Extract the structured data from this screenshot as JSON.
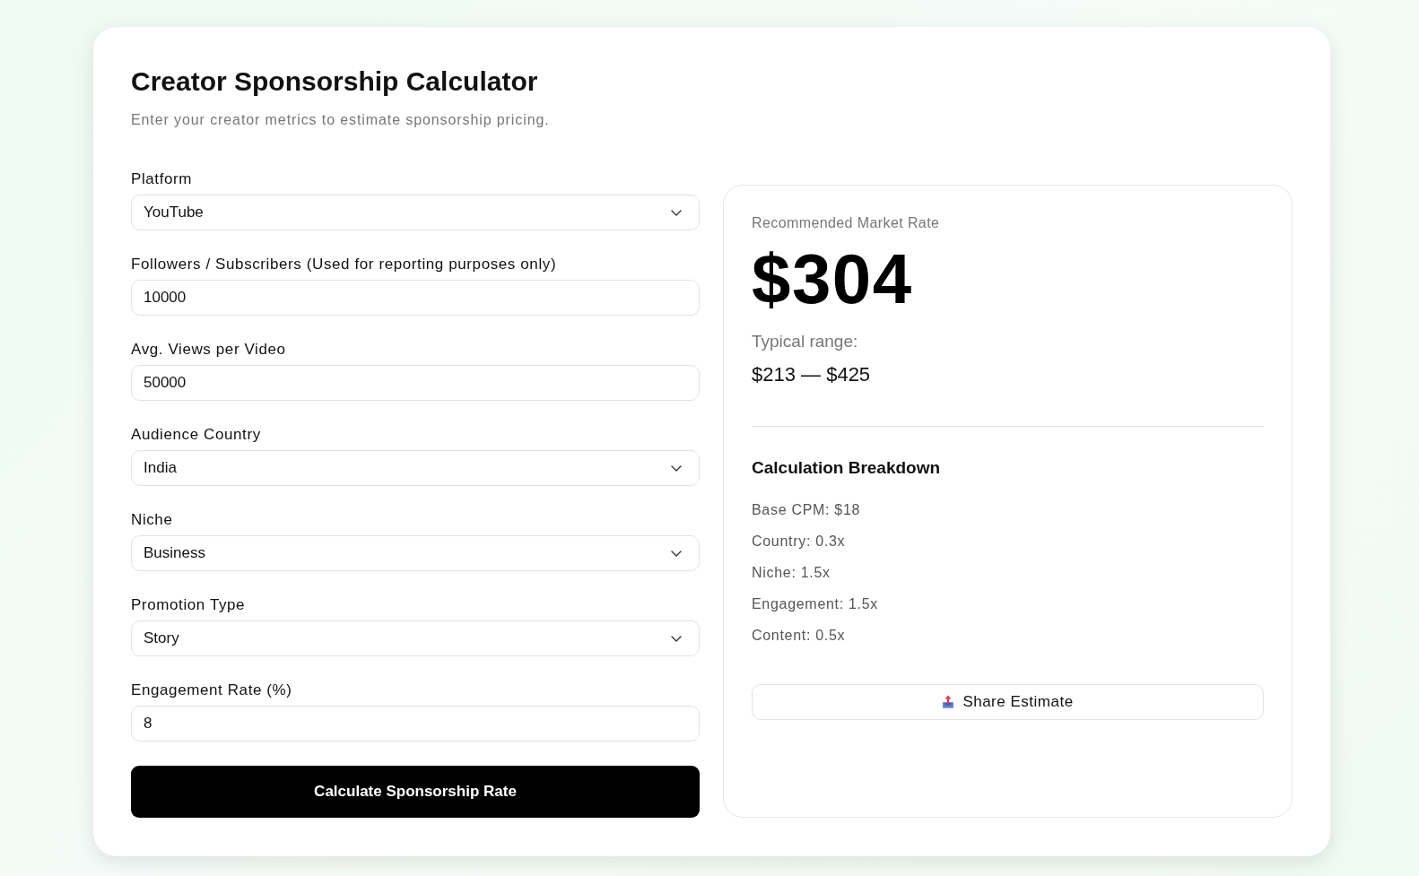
{
  "header": {
    "title": "Creator Sponsorship Calculator",
    "subtitle": "Enter your creator metrics to estimate sponsorship pricing."
  },
  "form": {
    "fields": [
      {
        "kind": "select",
        "label": "Platform",
        "value": "YouTube"
      },
      {
        "kind": "input",
        "label": "Followers / Subscribers (Used for reporting purposes only)",
        "value": "10000"
      },
      {
        "kind": "input",
        "label": "Avg. Views per Video",
        "value": "50000"
      },
      {
        "kind": "select",
        "label": "Audience Country",
        "value": "India"
      },
      {
        "kind": "select",
        "label": "Niche",
        "value": "Business"
      },
      {
        "kind": "select",
        "label": "Promotion Type",
        "value": "Story"
      },
      {
        "kind": "input",
        "label": "Engagement Rate (%)",
        "value": "8"
      }
    ],
    "submit": "Calculate Sponsorship Rate"
  },
  "result": {
    "label": "Recommended Market Rate",
    "rate": "$304",
    "range_label": "Typical range:",
    "range": "$213 — $425",
    "breakdown_title": "Calculation Breakdown",
    "breakdown": [
      "Base CPM: $18",
      "Country: 0.3x",
      "Niche: 1.5x",
      "Engagement: 1.5x",
      "Content: 0.5x"
    ],
    "share": "Share Estimate"
  }
}
